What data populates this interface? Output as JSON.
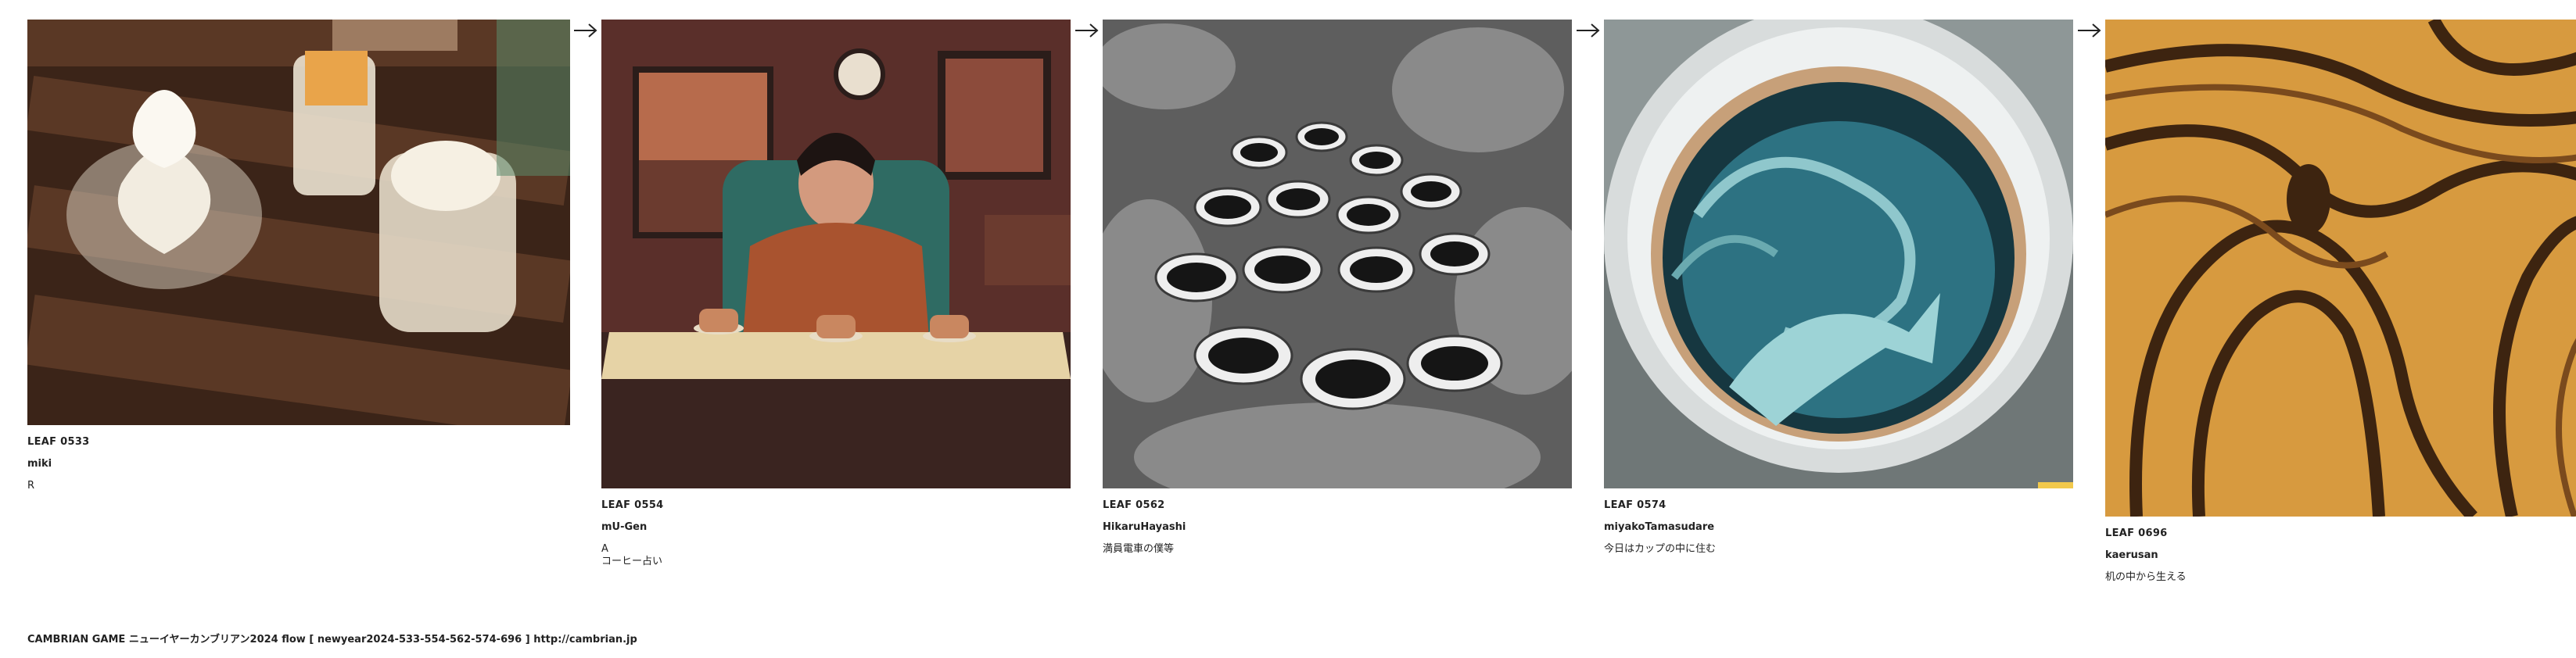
{
  "cards": [
    {
      "leaf": "LEAF 0533",
      "author": "miki",
      "title": "R"
    },
    {
      "leaf": "LEAF 0554",
      "author": "mU-Gen",
      "title": "A\nコーヒー占い"
    },
    {
      "leaf": "LEAF 0562",
      "author": "HikaruHayashi",
      "title": "満員電車の僕等"
    },
    {
      "leaf": "LEAF 0574",
      "author": "miyakoTamasudare",
      "title": "今日はカップの中に住む"
    },
    {
      "leaf": "LEAF 0696",
      "author": "kaerusan",
      "title": "机の中から生える"
    }
  ],
  "footer": "CAMBRIAN GAME  ニューイヤーカンブリアン2024  flow [ newyear2024-533-554-562-574-696 ]    http://cambrian.jp"
}
